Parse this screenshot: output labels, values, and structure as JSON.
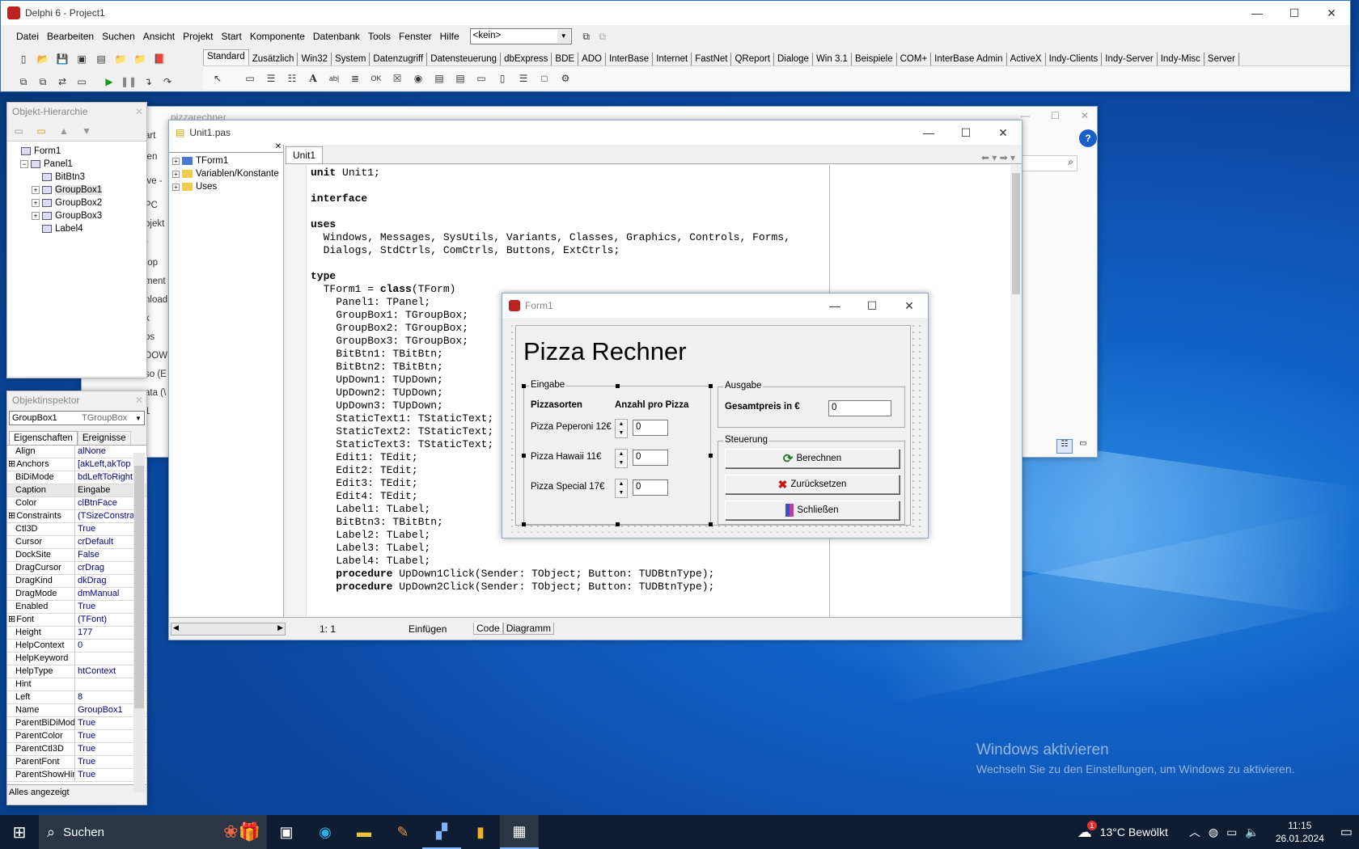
{
  "desktop": {
    "watermark_title": "Windows aktivieren",
    "watermark_sub": "Wechseln Sie zu den Einstellungen, um Windows zu aktivieren."
  },
  "ide": {
    "title": "Delphi 6 - Project1",
    "menu": [
      "Datei",
      "Bearbeiten",
      "Suchen",
      "Ansicht",
      "Projekt",
      "Start",
      "Komponente",
      "Datenbank",
      "Tools",
      "Fenster",
      "Hilfe"
    ],
    "config_combo": "<kein>",
    "palette_tabs": [
      "Standard",
      "Zusätzlich",
      "Win32",
      "System",
      "Datenzugriff",
      "Datensteuerung",
      "dbExpress",
      "BDE",
      "ADO",
      "InterBase",
      "Internet",
      "FastNet",
      "QReport",
      "Dialoge",
      "Win 3.1",
      "Beispiele",
      "COM+",
      "InterBase Admin",
      "ActiveX",
      "Indy-Clients",
      "Indy-Server",
      "Indy-Misc",
      "Server"
    ]
  },
  "hierarchy": {
    "title": "Objekt-Hierarchie",
    "items": [
      {
        "label": "Form1",
        "indent": 0,
        "exp": ""
      },
      {
        "label": "Panel1",
        "indent": 1,
        "exp": "−"
      },
      {
        "label": "BitBtn3",
        "indent": 2,
        "exp": ""
      },
      {
        "label": "GroupBox1",
        "indent": 2,
        "exp": "+"
      },
      {
        "label": "GroupBox2",
        "indent": 2,
        "exp": "+"
      },
      {
        "label": "GroupBox3",
        "indent": 2,
        "exp": "+"
      },
      {
        "label": "Label4",
        "indent": 2,
        "exp": ""
      }
    ]
  },
  "inspector": {
    "title": "Objektinspektor",
    "selected_name": "GroupBox1",
    "selected_type": "TGroupBox",
    "tab_props": "Eigenschaften",
    "tab_events": "Ereignisse",
    "status": "Alles angezeigt",
    "props": [
      [
        "Align",
        "alNone"
      ],
      [
        "Anchors",
        "[akLeft,akTop"
      ],
      [
        "BiDiMode",
        "bdLeftToRight"
      ],
      [
        "Caption",
        "Eingabe"
      ],
      [
        "Color",
        "clBtnFace"
      ],
      [
        "Constraints",
        "(TSizeConstra"
      ],
      [
        "Ctl3D",
        "True"
      ],
      [
        "Cursor",
        "crDefault"
      ],
      [
        "DockSite",
        "False"
      ],
      [
        "DragCursor",
        "crDrag"
      ],
      [
        "DragKind",
        "dkDrag"
      ],
      [
        "DragMode",
        "dmManual"
      ],
      [
        "Enabled",
        "True"
      ],
      [
        "Font",
        "(TFont)"
      ],
      [
        "Height",
        "177"
      ],
      [
        "HelpContext",
        "0"
      ],
      [
        "HelpKeyword",
        ""
      ],
      [
        "HelpType",
        "htContext"
      ],
      [
        "Hint",
        ""
      ],
      [
        "Left",
        "8"
      ],
      [
        "Name",
        "GroupBox1"
      ],
      [
        "ParentBiDiMod",
        "True"
      ],
      [
        "ParentColor",
        "True"
      ],
      [
        "ParentCtl3D",
        "True"
      ],
      [
        "ParentFont",
        "True"
      ],
      [
        "ParentShowHir",
        "True"
      ]
    ]
  },
  "behind": {
    "title": "pizzarechner",
    "fragments": [
      "art",
      "len",
      "ive -",
      "PC",
      "bjekt",
      "r",
      "top",
      "ment",
      "nload",
      "k",
      "os",
      "DOWS",
      "so (E",
      "ata (\\",
      "1"
    ]
  },
  "editor": {
    "title": "Unit1.pas",
    "tab": "Unit1",
    "explorer": [
      "TForm1",
      "Variablen/Konstante",
      "Uses"
    ],
    "status_pos": "1:   1",
    "status_mode": "Einfügen",
    "tab_code": "Code",
    "tab_diagram": "Diagramm",
    "code_lines": [
      [
        "kw",
        "unit",
        " Unit1;"
      ],
      [
        "",
        ""
      ],
      [
        "kw",
        "interface",
        ""
      ],
      [
        "",
        ""
      ],
      [
        "kw",
        "uses",
        ""
      ],
      [
        "",
        "  Windows, Messages, SysUtils, Variants, Classes, Graphics, Controls, Forms,"
      ],
      [
        "",
        "  Dialogs, StdCtrls, ComCtrls, Buttons, ExtCtrls;"
      ],
      [
        "",
        ""
      ],
      [
        "kw",
        "type",
        ""
      ],
      [
        "mix",
        "  TForm1 = ",
        "class",
        "(TForm)"
      ],
      [
        "",
        "    Panel1: TPanel;"
      ],
      [
        "",
        "    GroupBox1: TGroupBox;"
      ],
      [
        "",
        "    GroupBox2: TGroupBox;"
      ],
      [
        "",
        "    GroupBox3: TGroupBox;"
      ],
      [
        "",
        "    BitBtn1: TBitBtn;"
      ],
      [
        "",
        "    BitBtn2: TBitBtn;"
      ],
      [
        "",
        "    UpDown1: TUpDown;"
      ],
      [
        "",
        "    UpDown2: TUpDown;"
      ],
      [
        "",
        "    UpDown3: TUpDown;"
      ],
      [
        "",
        "    StaticText1: TStaticText;"
      ],
      [
        "",
        "    StaticText2: TStaticText;"
      ],
      [
        "",
        "    StaticText3: TStaticText;"
      ],
      [
        "",
        "    Edit1: TEdit;"
      ],
      [
        "",
        "    Edit2: TEdit;"
      ],
      [
        "",
        "    Edit3: TEdit;"
      ],
      [
        "",
        "    Edit4: TEdit;"
      ],
      [
        "",
        "    Label1: TLabel;"
      ],
      [
        "",
        "    BitBtn3: TBitBtn;"
      ],
      [
        "",
        "    Label2: TLabel;"
      ],
      [
        "",
        "    Label3: TLabel;"
      ],
      [
        "",
        "    Label4: TLabel;"
      ],
      [
        "mix",
        "    ",
        "procedure",
        " UpDown1Click(Sender: TObject; Button: TUDBtnType);"
      ],
      [
        "mix",
        "    ",
        "procedure",
        " UpDown2Click(Sender: TObject; Button: TUDBtnType);"
      ]
    ]
  },
  "form": {
    "title": "Form1",
    "heading": "Pizza Rechner",
    "eingabe": {
      "caption": "Eingabe",
      "col1": "Pizzasorten",
      "col2": "Anzahl pro Pizza",
      "rows": [
        {
          "label": "Pizza Peperoni 12€",
          "value": "0"
        },
        {
          "label": "Pizza Hawaii 11€",
          "value": "0"
        },
        {
          "label": "Pizza Special 17€",
          "value": "0"
        }
      ]
    },
    "ausgabe": {
      "caption": "Ausgabe",
      "label": "Gesamtpreis in €",
      "value": "0"
    },
    "steuerung": {
      "caption": "Steuerung",
      "btn_calc": "Berechnen",
      "btn_reset": "Zurücksetzen",
      "btn_close": "Schließen"
    }
  },
  "taskbar": {
    "search": "Suchen",
    "weather": "13°C  Bewölkt",
    "weather_badge": "1",
    "time": "11:15",
    "date": "26.01.2024"
  },
  "colors": {
    "accent": "#0078d7",
    "taskbar": "#0f1d33",
    "ide_bg": "#f0f0f0"
  }
}
